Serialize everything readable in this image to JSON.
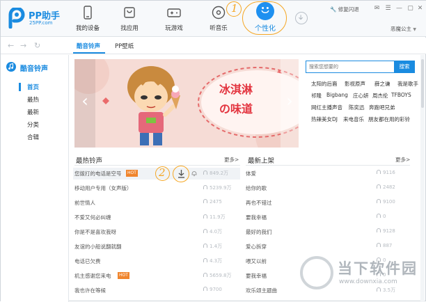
{
  "logo": {
    "name": "PP助手",
    "site": "25PP.com"
  },
  "nav": {
    "items": [
      {
        "label": "我的设备",
        "icon": "phone-icon"
      },
      {
        "label": "找应用",
        "icon": "shopping-bag-icon"
      },
      {
        "label": "玩游戏",
        "icon": "gamepad-icon"
      },
      {
        "label": "听音乐",
        "icon": "music-disc-icon"
      },
      {
        "label": "个性化",
        "icon": "smiley-icon"
      }
    ]
  },
  "topright": {
    "repair": "修复闪退",
    "user": "恶魔公主"
  },
  "annotations": {
    "one": "1",
    "two": "2"
  },
  "tabs": {
    "ringtone": "酷音铃声",
    "wallpaper": "PP壁纸"
  },
  "sidebar": {
    "title": "酷音铃声",
    "items": [
      "首页",
      "最热",
      "最新",
      "分类",
      "合辑"
    ]
  },
  "banner": {
    "line1": "冰淇淋",
    "line2": "の味道"
  },
  "search": {
    "placeholder": "搜索您想要的",
    "button": "搜索"
  },
  "tags": [
    [
      "太阳的后裔",
      "影视原声",
      "薛之谦",
      "我是歌手"
    ],
    [
      "祁隆",
      "Bigbang",
      "庄心妍",
      "周杰伦",
      "TFBOYS"
    ],
    [
      "网红主播声音",
      "陈奕迅",
      "奔跑吧兄弟"
    ],
    [
      "热辣美女DJ",
      "来电音乐",
      "朋友都在用的彩铃"
    ]
  ],
  "lists": {
    "hot": {
      "title": "最热铃声",
      "more": "更多>",
      "rows": [
        {
          "title": "您拨打的电话是空号",
          "hot": "HOT",
          "count": "849.2万"
        },
        {
          "title": "移动用户专用（女声版）",
          "count": "5239.9万"
        },
        {
          "title": "前世情人",
          "count": "2475"
        },
        {
          "title": "不爱又何必纠缠",
          "count": "11.9万"
        },
        {
          "title": "你是不是喜欢我呀",
          "count": "4.0万"
        },
        {
          "title": "友谊的小船说翻就翻",
          "count": "1.4万"
        },
        {
          "title": "电话已欠费",
          "count": "4.3万"
        },
        {
          "title": "机主感谢您来电",
          "hot": "HOT",
          "count": "5659.8万"
        },
        {
          "title": "我也许在等候",
          "count": "9700"
        }
      ]
    },
    "new": {
      "title": "最新上架",
      "more": "更多>",
      "rows": [
        {
          "title": "体爱",
          "count": "9116"
        },
        {
          "title": "给你的歌",
          "count": "2482"
        },
        {
          "title": "再也不错过",
          "count": "9100"
        },
        {
          "title": "要我幸福",
          "count": "0"
        },
        {
          "title": "最好的我们",
          "count": "9128"
        },
        {
          "title": "爱心拆穿",
          "count": "887"
        },
        {
          "title": "喂又以前",
          "count": "0"
        },
        {
          "title": "要我幸福",
          "count": "0"
        },
        {
          "title": "欢乐颂主题曲",
          "count": "3.5万"
        }
      ]
    }
  },
  "watermark": {
    "name": "当下软件园",
    "url": "www.downxia.com"
  },
  "colors": {
    "accent": "#1a8be0",
    "annotation": "#f5a623",
    "hot": "#f0852d"
  }
}
